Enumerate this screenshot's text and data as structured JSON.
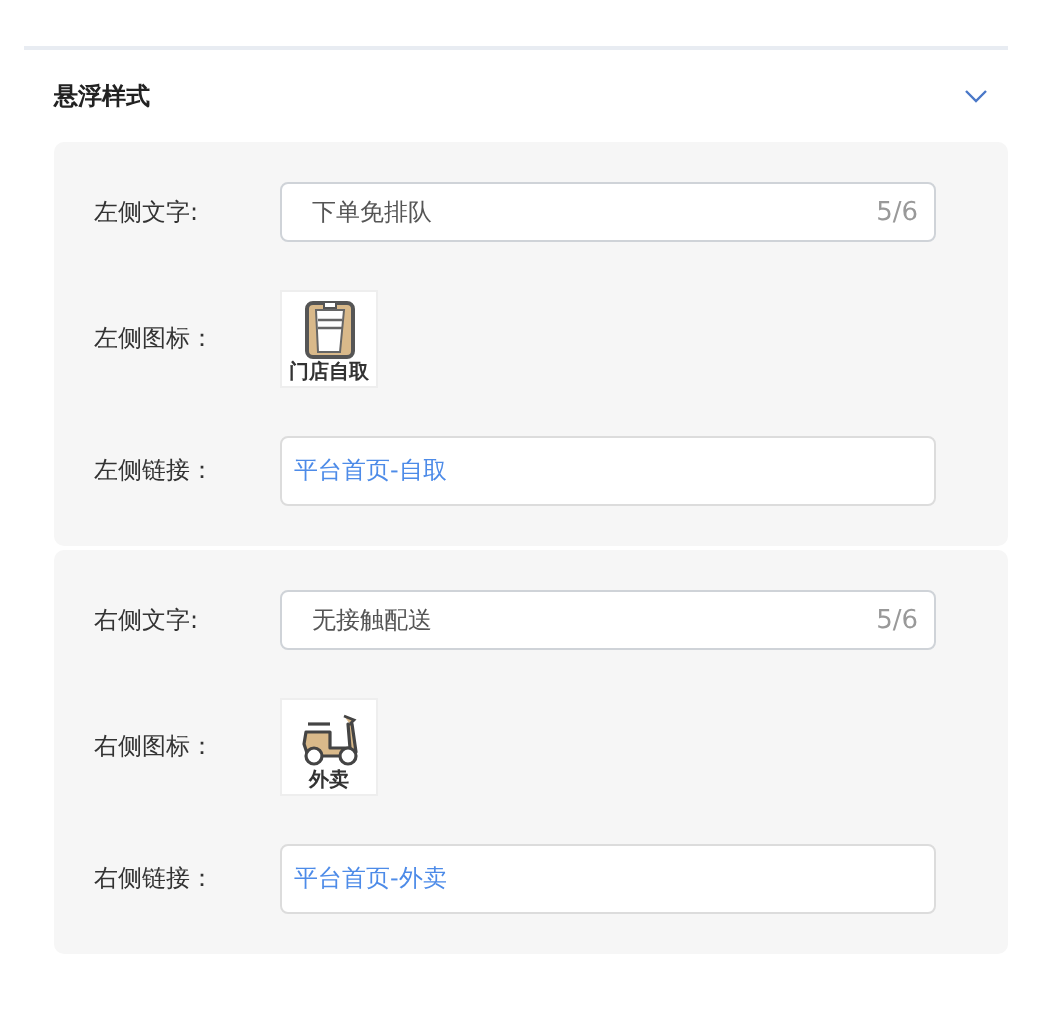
{
  "section": {
    "title": "悬浮样式",
    "expanded": true
  },
  "groups": [
    {
      "fields": [
        {
          "kind": "text",
          "label": "左侧文字:",
          "value": "下单免排队",
          "counter": "5/6"
        },
        {
          "kind": "icon",
          "label": "左侧图标：",
          "caption": "门店自取"
        },
        {
          "kind": "link",
          "label": "左侧链接：",
          "value": "平台首页-自取"
        }
      ]
    },
    {
      "fields": [
        {
          "kind": "text",
          "label": "右侧文字:",
          "value": "无接触配送",
          "counter": "5/6"
        },
        {
          "kind": "icon",
          "label": "右侧图标：",
          "caption": "外卖"
        },
        {
          "kind": "link",
          "label": "右侧链接：",
          "value": "平台首页-外卖"
        }
      ]
    }
  ]
}
